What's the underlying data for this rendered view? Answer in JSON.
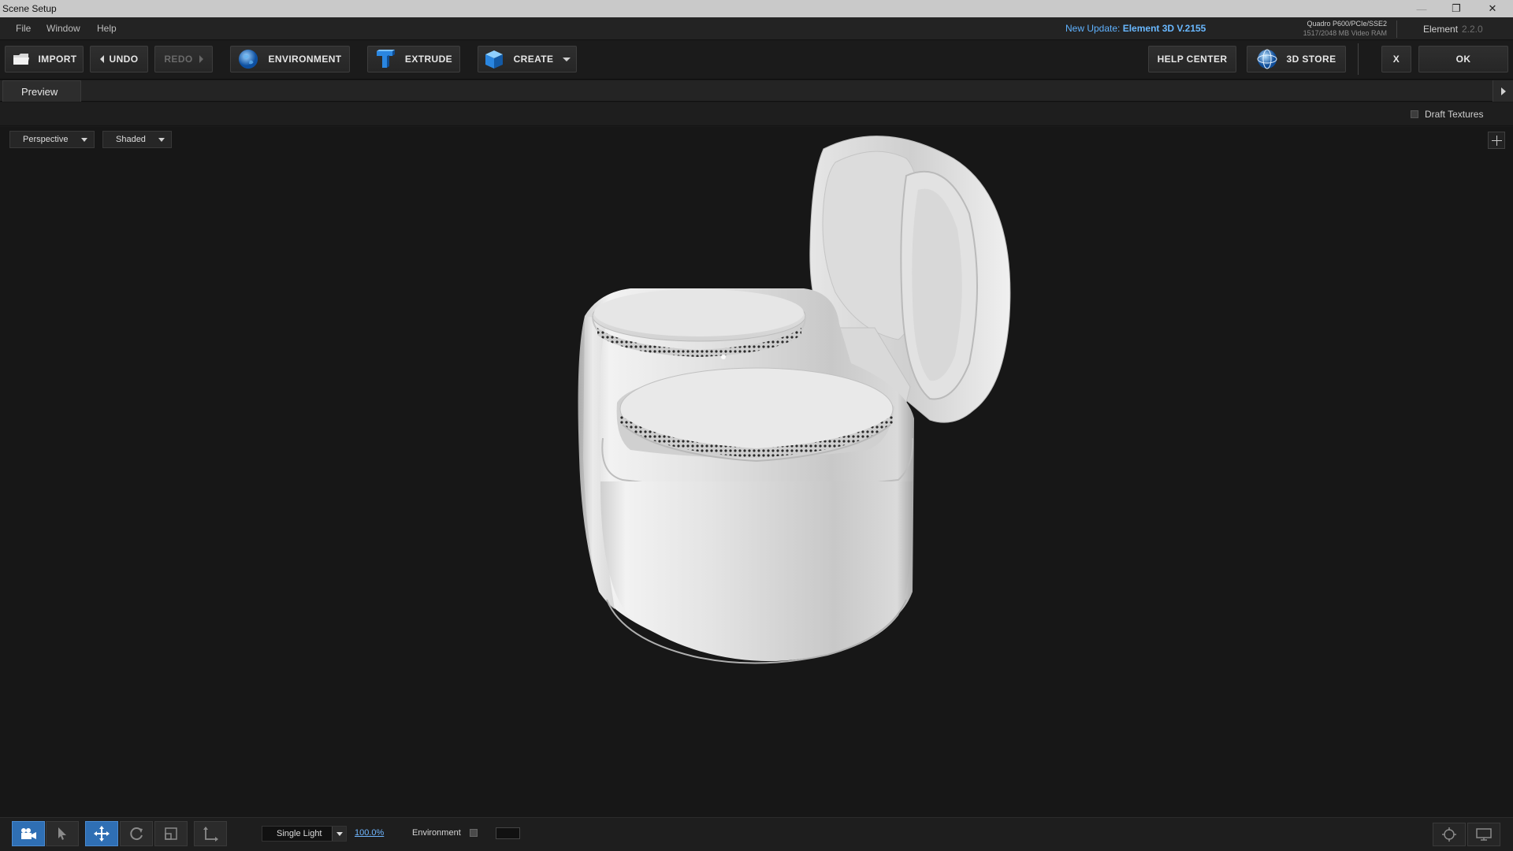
{
  "window": {
    "title": "Scene Setup",
    "controls": [
      "—",
      "❐",
      "✕"
    ]
  },
  "menu": {
    "items": [
      "File",
      "Window",
      "Help"
    ],
    "update_prefix": "New Update:",
    "update_version": "Element 3D V.2155",
    "gpu_name": "Quadro P600/PCIe/SSE2",
    "gpu_ram": "1517/2048 MB Video RAM",
    "app_name": "Element",
    "app_version": "2.2.0"
  },
  "toolbar": {
    "import": "IMPORT",
    "undo": "UNDO",
    "redo": "REDO",
    "environment": "ENVIRONMENT",
    "extrude": "EXTRUDE",
    "create": "CREATE",
    "help_center": "HELP CENTER",
    "store": "3D STORE",
    "close": "X",
    "ok": "OK"
  },
  "tabs": {
    "preview": "Preview"
  },
  "options": {
    "draft_textures": "Draft Textures",
    "draft_textures_checked": false
  },
  "viewport": {
    "camera": "Perspective",
    "shading": "Shaded"
  },
  "bottom": {
    "light_mode": "Single Light",
    "light_intensity": "100.0%",
    "environment_label": "Environment",
    "environment_checked": false
  },
  "colors": {
    "accent": "#2f6fb4",
    "link": "#6fb6ff",
    "background": "#171717"
  }
}
